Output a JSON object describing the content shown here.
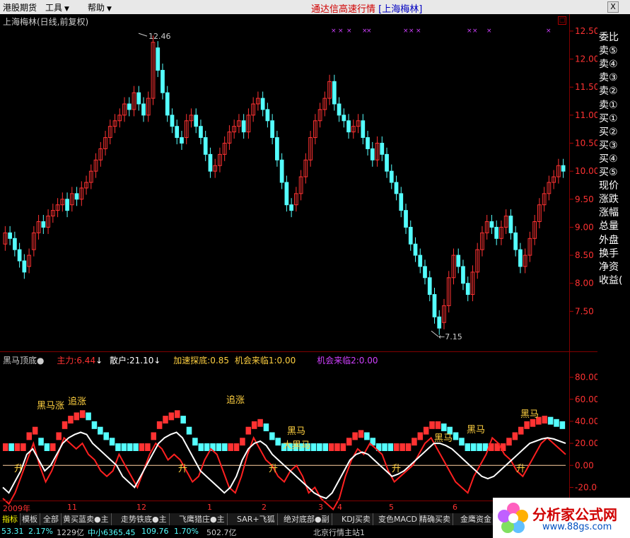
{
  "menu": {
    "items": [
      {
        "label": "港股期货"
      },
      {
        "label": "工具"
      },
      {
        "label": "帮助"
      }
    ]
  },
  "app_title": {
    "main": "通达信高速行情",
    "sub": "[上海梅林]"
  },
  "window": {
    "close_label": "X",
    "restore_label": "□"
  },
  "chart_header": {
    "stock": "上海梅林(日线,前复权)"
  },
  "price_axis": {
    "ticks": [
      "12.50",
      "12.00",
      "11.50",
      "11.00",
      "10.50",
      "10.00",
      "9.50",
      "9.00",
      "8.50",
      "8.00",
      "7.50"
    ]
  },
  "price_annot": {
    "high": "12.46",
    "low": "7.15"
  },
  "indicator_header": {
    "name": "黑马顶底●",
    "zhuli": "主力:6.44",
    "sanhu": "散户:21.10",
    "jiasu": "加速探底:0.85",
    "jihui1": "机会来临1:0.00",
    "jihui2": "机会来临2:0.00"
  },
  "ind_axis": {
    "ticks": [
      "80.00",
      "60.00",
      "40.00",
      "20.00",
      "0.00",
      "-20.00"
    ]
  },
  "ind_labels": {
    "heima": "黑马",
    "zhuizhang": "追涨",
    "sheng": "升",
    "dahema": "大黑马"
  },
  "x_axis": {
    "labels": [
      "2009年",
      "11",
      "12",
      "1",
      "2",
      "3",
      "4",
      "5",
      "6"
    ]
  },
  "right_panel": {
    "items": [
      "委比",
      "卖⑤",
      "卖④",
      "卖③",
      "卖②",
      "卖①",
      "买①",
      "买②",
      "买③",
      "买④",
      "买⑤",
      "现价",
      "涨跌",
      "涨幅",
      "总量",
      "外盘",
      "换手",
      "净资",
      "收益("
    ]
  },
  "tabs": [
    "指标",
    "模板",
    "全部",
    "黄买蓝卖●主",
    "走势铁底●主",
    "飞鹰猎庄●主",
    "SAR+飞狐",
    "绝对底部●副",
    "KDJ买卖",
    "变色MACD",
    "精确买卖",
    "金鹰资金"
  ],
  "status": {
    "s1": "53.31",
    "s2": "2.17%",
    "s3": "1229亿",
    "s4": "中小6365.45",
    "s5": "109.76",
    "s6": "1.70%",
    "s7": "502.7亿",
    "s8": "北京行情主站1"
  },
  "logo": {
    "text": "分析家公式网",
    "url": "www.88gs.com"
  },
  "colors": {
    "up": "#ff3232",
    "down": "#54ffff",
    "accent": "#d00000"
  },
  "chart_data": [
    {
      "type": "candlestick",
      "title": "上海梅林(日线,前复权)",
      "ylim": [
        7.0,
        12.6
      ],
      "y_ticks": [
        7.5,
        8.0,
        8.5,
        9.0,
        9.5,
        10.0,
        10.5,
        11.0,
        11.5,
        12.0,
        12.5
      ],
      "annotations": [
        {
          "label": "12.46",
          "value": 12.46
        },
        {
          "label": "7.15",
          "value": 7.15
        }
      ],
      "x_labels": [
        "2009年",
        "11",
        "12",
        "1",
        "2",
        "3",
        "4",
        "5",
        "6"
      ],
      "close": [
        8.9,
        8.8,
        8.6,
        8.4,
        8.2,
        8.5,
        8.9,
        9.1,
        9.0,
        9.2,
        9.3,
        9.4,
        9.5,
        9.3,
        9.6,
        9.5,
        9.7,
        9.8,
        10.0,
        10.2,
        10.4,
        10.6,
        10.8,
        10.9,
        11.0,
        11.2,
        11.1,
        11.4,
        11.2,
        11.0,
        11.3,
        12.3,
        11.8,
        11.4,
        11.0,
        10.8,
        10.6,
        10.5,
        10.9,
        11.0,
        10.8,
        10.6,
        10.3,
        10.0,
        10.1,
        10.3,
        10.5,
        10.7,
        10.8,
        10.9,
        10.7,
        11.0,
        11.2,
        11.3,
        11.1,
        10.9,
        10.6,
        10.2,
        9.8,
        9.4,
        9.3,
        9.6,
        9.9,
        10.2,
        10.6,
        10.9,
        11.1,
        11.3,
        11.6,
        11.2,
        11.0,
        10.9,
        10.7,
        10.8,
        10.9,
        10.6,
        10.4,
        10.2,
        10.5,
        10.3,
        10.0,
        9.8,
        9.6,
        9.3,
        9.0,
        8.7,
        8.5,
        8.3,
        8.1,
        7.8,
        7.4,
        7.2,
        7.6,
        8.1,
        8.5,
        8.3,
        8.0,
        7.8,
        8.2,
        8.6,
        8.9,
        9.1,
        9.0,
        8.8,
        9.0,
        9.2,
        8.9,
        8.6,
        8.3,
        8.5,
        8.8,
        9.1,
        9.4,
        9.6,
        9.8,
        9.9,
        10.1,
        10.0
      ],
      "open": [
        8.7,
        8.9,
        8.8,
        8.6,
        8.4,
        8.3,
        8.6,
        8.9,
        9.1,
        9.0,
        9.2,
        9.3,
        9.4,
        9.5,
        9.4,
        9.6,
        9.5,
        9.7,
        9.8,
        10.0,
        10.2,
        10.4,
        10.6,
        10.8,
        10.9,
        11.0,
        11.2,
        11.1,
        11.4,
        11.2,
        11.0,
        11.3,
        12.2,
        11.8,
        11.4,
        11.0,
        10.8,
        10.6,
        10.6,
        10.9,
        11.0,
        10.8,
        10.6,
        10.3,
        10.0,
        10.1,
        10.3,
        10.5,
        10.7,
        10.8,
        10.9,
        10.7,
        11.0,
        11.2,
        11.3,
        11.1,
        10.9,
        10.6,
        10.2,
        9.8,
        9.4,
        9.4,
        9.6,
        9.9,
        10.2,
        10.6,
        10.9,
        11.1,
        11.3,
        11.6,
        11.2,
        11.0,
        10.9,
        10.7,
        10.8,
        10.9,
        10.6,
        10.4,
        10.2,
        10.5,
        10.3,
        10.0,
        9.8,
        9.6,
        9.3,
        9.0,
        8.7,
        8.5,
        8.3,
        8.1,
        7.8,
        7.4,
        7.3,
        7.6,
        8.1,
        8.5,
        8.3,
        8.0,
        7.8,
        8.2,
        8.6,
        8.9,
        9.1,
        9.0,
        8.8,
        9.0,
        9.2,
        8.9,
        8.6,
        8.3,
        8.5,
        8.8,
        9.1,
        9.4,
        9.6,
        9.8,
        9.9,
        10.1
      ]
    },
    {
      "type": "line",
      "title": "黑马顶底",
      "ylim": [
        -30,
        90
      ],
      "y_ticks": [
        -20,
        0,
        20,
        40,
        60,
        80
      ],
      "series": [
        {
          "name": "主力",
          "color": "#ffffff",
          "values": [
            -20,
            -25,
            -15,
            -5,
            10,
            15,
            5,
            -5,
            0,
            10,
            20,
            25,
            28,
            30,
            28,
            20,
            15,
            10,
            5,
            0,
            -10,
            -15,
            -20,
            -10,
            0,
            10,
            20,
            25,
            28,
            30,
            25,
            15,
            5,
            -5,
            -10,
            -15,
            -20,
            -25,
            -20,
            -10,
            5,
            15,
            20,
            22,
            18,
            10,
            5,
            0,
            -5,
            -10,
            -15,
            -20,
            -25,
            -28,
            -30,
            -25,
            -15,
            -5,
            5,
            10,
            12,
            10,
            5,
            0,
            -5,
            -10,
            -8,
            -5,
            0,
            5,
            10,
            15,
            20,
            20,
            18,
            15,
            10,
            5,
            0,
            -5,
            -10,
            -12,
            -10,
            -5,
            0,
            5,
            10,
            15,
            20,
            22,
            24,
            25,
            24,
            22,
            20
          ]
        },
        {
          "name": "散户",
          "color": "#ff2020",
          "values": [
            -30,
            -35,
            -25,
            -10,
            5,
            20,
            0,
            -15,
            -5,
            10,
            25,
            20,
            15,
            20,
            10,
            5,
            -5,
            -10,
            -5,
            10,
            0,
            -10,
            -20,
            -5,
            10,
            20,
            15,
            5,
            10,
            5,
            -5,
            -15,
            -10,
            5,
            15,
            10,
            -5,
            -20,
            -25,
            -10,
            10,
            25,
            15,
            5,
            0,
            -10,
            -15,
            -5,
            0,
            -10,
            -25,
            -20,
            -30,
            -35,
            -40,
            -30,
            -10,
            5,
            15,
            10,
            20,
            15,
            10,
            -5,
            -15,
            -10,
            -5,
            0,
            10,
            20,
            25,
            15,
            5,
            -5,
            -15,
            -20,
            -25,
            -10,
            0,
            10,
            25,
            20,
            10,
            5,
            -5,
            -10,
            0,
            10,
            20,
            25,
            20,
            15,
            10
          ]
        },
        {
          "name": "加速探底",
          "color": "#ffd040",
          "values": []
        }
      ]
    }
  ]
}
